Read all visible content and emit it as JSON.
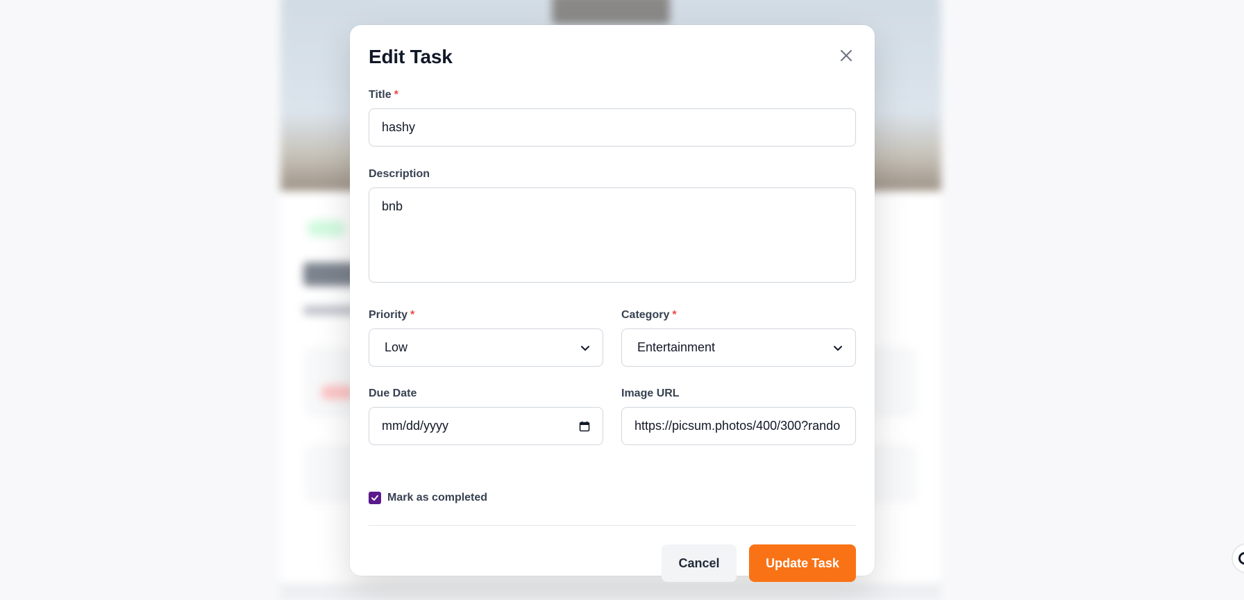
{
  "modal": {
    "title": "Edit Task",
    "close_icon": "close-icon"
  },
  "fields": {
    "title": {
      "label": "Title",
      "required_mark": "*",
      "value": "hashy"
    },
    "description": {
      "label": "Description",
      "value": "bnb"
    },
    "priority": {
      "label": "Priority",
      "required_mark": "*",
      "value": "Low",
      "icon": "chevron-down-icon"
    },
    "category": {
      "label": "Category",
      "required_mark": "*",
      "value": "Entertainment",
      "icon": "chevron-down-icon"
    },
    "due_date": {
      "label": "Due Date",
      "placeholder": "mm/dd/yyyy",
      "icon": "calendar-icon"
    },
    "image_url": {
      "label": "Image URL",
      "value": "https://picsum.photos/400/300?rando"
    }
  },
  "completed": {
    "label": "Mark as completed",
    "checked": true,
    "icon": "checkmark-icon"
  },
  "actions": {
    "cancel_label": "Cancel",
    "submit_label": "Update Task"
  },
  "colors": {
    "accent": "#f97316",
    "checkbox": "#5b1a8c",
    "required": "#ef4444"
  }
}
